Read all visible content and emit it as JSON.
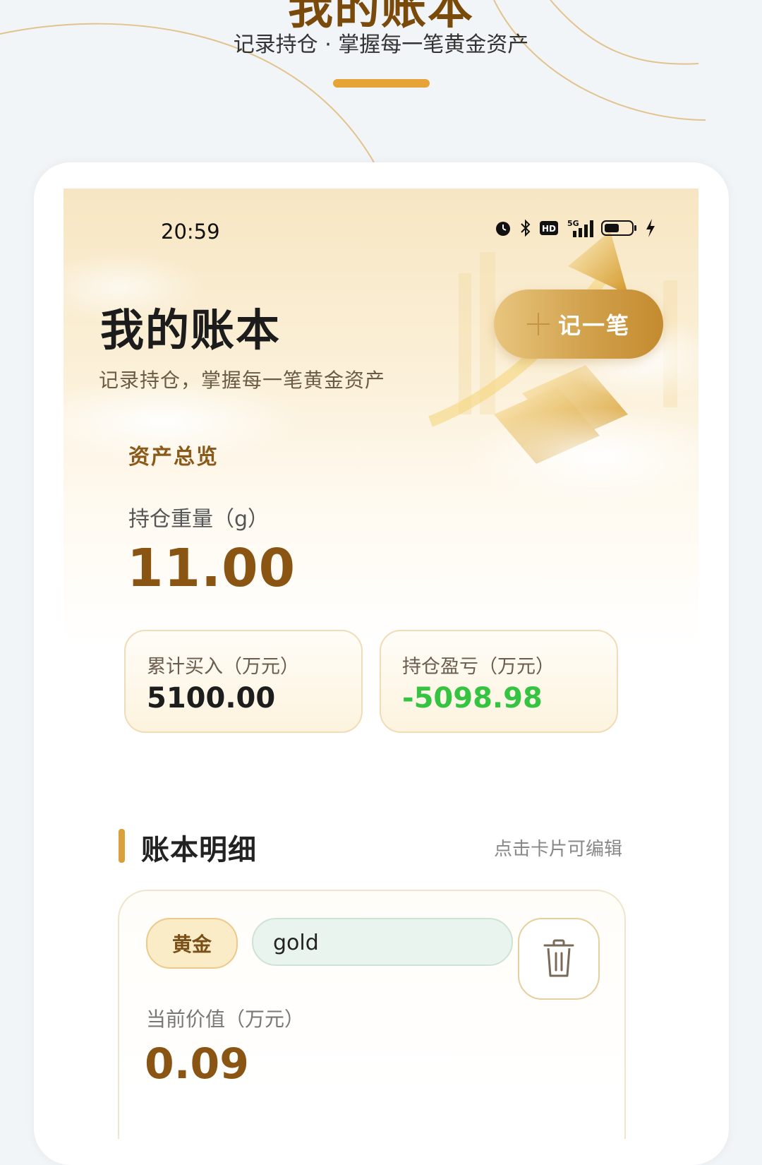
{
  "promo": {
    "title": "我的账本",
    "subtitle": "记录持仓 · 掌握每一笔黄金资产"
  },
  "status_bar": {
    "time": "20:59",
    "network": "5G",
    "hd": "HD",
    "icons": [
      "alarm-icon",
      "bluetooth-icon",
      "hd-icon",
      "signal-5g-icon",
      "battery-icon",
      "charging-icon"
    ]
  },
  "header": {
    "title": "我的账本",
    "subtitle": "记录持仓，掌握每一笔黄金资产",
    "add_button_label": "记一笔"
  },
  "overview": {
    "section_title": "资产总览",
    "weight_label": "持仓重量（g）",
    "weight_value": "11.00",
    "cards": [
      {
        "label": "累计买入（万元）",
        "value": "5100.00"
      },
      {
        "label": "持仓盈亏（万元）",
        "value": "-5098.98"
      }
    ]
  },
  "details": {
    "title": "账本明细",
    "hint": "点击卡片可编辑",
    "records": [
      {
        "tag": "黄金",
        "name": "gold",
        "value_label": "当前价值（万元）",
        "value": "0.09"
      }
    ]
  },
  "colors": {
    "accent_gold": "#d9a13b",
    "value_brown": "#8a5512",
    "loss_green": "#35c441"
  }
}
